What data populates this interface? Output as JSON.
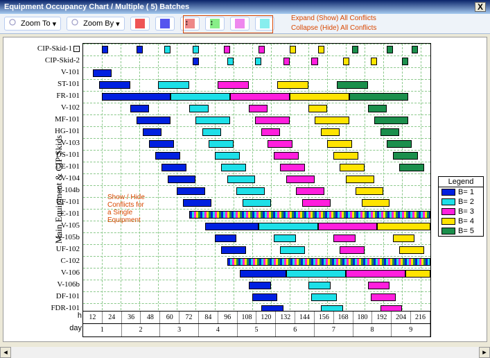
{
  "window": {
    "title": "Equipment Occupancy Chart / Multiple ( 5) Batches",
    "close": "X"
  },
  "toolbar": {
    "zoom_to": "Zoom To",
    "zoom_by": "Zoom By",
    "callout_expand": "Expand (Show) All Conflicts",
    "callout_collapse": "Collapse (Hide) All Conflicts"
  },
  "annotation_single": "Show / Hide\nConflicts for\na Single\nEquipment",
  "y_axis_label": "Main Equipment & CIP Skids",
  "legend": {
    "title": "Legend",
    "items": [
      "B= 1",
      "B= 2",
      "B= 3",
      "B= 4",
      "B= 5"
    ]
  },
  "x_axis": {
    "label_h": "h",
    "label_day": "day",
    "hours": [
      "12",
      "24",
      "36",
      "48",
      "60",
      "72",
      "84",
      "96",
      "108",
      "120",
      "132",
      "144",
      "156",
      "168",
      "180",
      "192",
      "204",
      "216"
    ],
    "days": [
      "1",
      "2",
      "3",
      "4",
      "5",
      "6",
      "7",
      "8",
      "9"
    ]
  },
  "chart_data": {
    "type": "gantt",
    "title": "Equipment Occupancy Chart / Multiple ( 5) Batches",
    "xlabel": "h / day",
    "ylabel": "Main Equipment & CIP Skids",
    "xlim": [
      0,
      222
    ],
    "equipment": [
      "CIP-Skid-1",
      "CIP-Skid-2",
      "V-101",
      "ST-101",
      "FR-101",
      "V-102",
      "MF-101",
      "HG-101",
      "V-103",
      "DS-101",
      "DE-101",
      "V-104",
      "V-104b",
      "UF-101",
      "C-101",
      "V-105",
      "V-105b",
      "UF-102",
      "C-102",
      "V-106",
      "V-106b",
      "DF-101",
      "FDR-101"
    ],
    "series_colors": {
      "1": "#0020e0",
      "2": "#1de0e8",
      "3": "#ff1fdd",
      "4": "#ffe400",
      "5": "#1b8f4c"
    },
    "bars": [
      {
        "eq": "CIP-Skid-1",
        "batch": 1,
        "start": 12,
        "end": 16
      },
      {
        "eq": "CIP-Skid-1",
        "batch": 1,
        "start": 34,
        "end": 38
      },
      {
        "eq": "CIP-Skid-1",
        "batch": 2,
        "start": 52,
        "end": 56
      },
      {
        "eq": "CIP-Skid-1",
        "batch": 2,
        "start": 70,
        "end": 74
      },
      {
        "eq": "CIP-Skid-1",
        "batch": 3,
        "start": 90,
        "end": 94
      },
      {
        "eq": "CIP-Skid-1",
        "batch": 3,
        "start": 112,
        "end": 116
      },
      {
        "eq": "CIP-Skid-1",
        "batch": 4,
        "start": 132,
        "end": 136
      },
      {
        "eq": "CIP-Skid-1",
        "batch": 4,
        "start": 150,
        "end": 154
      },
      {
        "eq": "CIP-Skid-1",
        "batch": 5,
        "start": 172,
        "end": 176
      },
      {
        "eq": "CIP-Skid-1",
        "batch": 5,
        "start": 194,
        "end": 198
      },
      {
        "eq": "CIP-Skid-1",
        "batch": 5,
        "start": 210,
        "end": 214
      },
      {
        "eq": "CIP-Skid-2",
        "batch": 1,
        "start": 70,
        "end": 74
      },
      {
        "eq": "CIP-Skid-2",
        "batch": 2,
        "start": 92,
        "end": 96
      },
      {
        "eq": "CIP-Skid-2",
        "batch": 2,
        "start": 110,
        "end": 114
      },
      {
        "eq": "CIP-Skid-2",
        "batch": 3,
        "start": 128,
        "end": 132
      },
      {
        "eq": "CIP-Skid-2",
        "batch": 3,
        "start": 146,
        "end": 150
      },
      {
        "eq": "CIP-Skid-2",
        "batch": 4,
        "start": 166,
        "end": 170
      },
      {
        "eq": "CIP-Skid-2",
        "batch": 4,
        "start": 184,
        "end": 188
      },
      {
        "eq": "CIP-Skid-2",
        "batch": 5,
        "start": 204,
        "end": 208
      },
      {
        "eq": "V-101",
        "batch": 1,
        "start": 6,
        "end": 18
      },
      {
        "eq": "ST-101",
        "batch": 1,
        "start": 10,
        "end": 30
      },
      {
        "eq": "ST-101",
        "batch": 2,
        "start": 48,
        "end": 68
      },
      {
        "eq": "ST-101",
        "batch": 3,
        "start": 86,
        "end": 106
      },
      {
        "eq": "ST-101",
        "batch": 4,
        "start": 124,
        "end": 144
      },
      {
        "eq": "ST-101",
        "batch": 5,
        "start": 162,
        "end": 182
      },
      {
        "eq": "FR-101",
        "batch": 1,
        "start": 12,
        "end": 56
      },
      {
        "eq": "FR-101",
        "batch": 2,
        "start": 56,
        "end": 94
      },
      {
        "eq": "FR-101",
        "batch": 3,
        "start": 94,
        "end": 132
      },
      {
        "eq": "FR-101",
        "batch": 4,
        "start": 132,
        "end": 170
      },
      {
        "eq": "FR-101",
        "batch": 5,
        "start": 170,
        "end": 208
      },
      {
        "eq": "V-102",
        "batch": 1,
        "start": 30,
        "end": 42
      },
      {
        "eq": "V-102",
        "batch": 2,
        "start": 68,
        "end": 80
      },
      {
        "eq": "V-102",
        "batch": 3,
        "start": 106,
        "end": 118
      },
      {
        "eq": "V-102",
        "batch": 4,
        "start": 144,
        "end": 156
      },
      {
        "eq": "V-102",
        "batch": 5,
        "start": 182,
        "end": 194
      },
      {
        "eq": "MF-101",
        "batch": 1,
        "start": 34,
        "end": 56
      },
      {
        "eq": "MF-101",
        "batch": 2,
        "start": 72,
        "end": 94
      },
      {
        "eq": "MF-101",
        "batch": 3,
        "start": 110,
        "end": 132
      },
      {
        "eq": "MF-101",
        "batch": 4,
        "start": 148,
        "end": 170
      },
      {
        "eq": "MF-101",
        "batch": 5,
        "start": 186,
        "end": 208
      },
      {
        "eq": "HG-101",
        "batch": 1,
        "start": 38,
        "end": 50
      },
      {
        "eq": "HG-101",
        "batch": 2,
        "start": 76,
        "end": 88
      },
      {
        "eq": "HG-101",
        "batch": 3,
        "start": 114,
        "end": 126
      },
      {
        "eq": "HG-101",
        "batch": 4,
        "start": 152,
        "end": 164
      },
      {
        "eq": "HG-101",
        "batch": 5,
        "start": 190,
        "end": 202
      },
      {
        "eq": "V-103",
        "batch": 1,
        "start": 42,
        "end": 58
      },
      {
        "eq": "V-103",
        "batch": 2,
        "start": 80,
        "end": 96
      },
      {
        "eq": "V-103",
        "batch": 3,
        "start": 118,
        "end": 134
      },
      {
        "eq": "V-103",
        "batch": 4,
        "start": 156,
        "end": 172
      },
      {
        "eq": "V-103",
        "batch": 5,
        "start": 194,
        "end": 210
      },
      {
        "eq": "DS-101",
        "batch": 1,
        "start": 46,
        "end": 62
      },
      {
        "eq": "DS-101",
        "batch": 2,
        "start": 84,
        "end": 100
      },
      {
        "eq": "DS-101",
        "batch": 3,
        "start": 122,
        "end": 138
      },
      {
        "eq": "DS-101",
        "batch": 4,
        "start": 160,
        "end": 176
      },
      {
        "eq": "DS-101",
        "batch": 5,
        "start": 198,
        "end": 214
      },
      {
        "eq": "DE-101",
        "batch": 1,
        "start": 50,
        "end": 66
      },
      {
        "eq": "DE-101",
        "batch": 2,
        "start": 88,
        "end": 104
      },
      {
        "eq": "DE-101",
        "batch": 3,
        "start": 126,
        "end": 142
      },
      {
        "eq": "DE-101",
        "batch": 4,
        "start": 164,
        "end": 180
      },
      {
        "eq": "DE-101",
        "batch": 5,
        "start": 202,
        "end": 218
      },
      {
        "eq": "V-104",
        "batch": 1,
        "start": 54,
        "end": 72
      },
      {
        "eq": "V-104",
        "batch": 2,
        "start": 92,
        "end": 110
      },
      {
        "eq": "V-104",
        "batch": 3,
        "start": 130,
        "end": 148
      },
      {
        "eq": "V-104",
        "batch": 4,
        "start": 168,
        "end": 186
      },
      {
        "eq": "V-104b",
        "batch": 1,
        "start": 60,
        "end": 78
      },
      {
        "eq": "V-104b",
        "batch": 2,
        "start": 98,
        "end": 116
      },
      {
        "eq": "V-104b",
        "batch": 3,
        "start": 136,
        "end": 154
      },
      {
        "eq": "V-104b",
        "batch": 4,
        "start": 174,
        "end": 192
      },
      {
        "eq": "UF-101",
        "batch": 1,
        "start": 64,
        "end": 82
      },
      {
        "eq": "UF-101",
        "batch": 2,
        "start": 102,
        "end": 120
      },
      {
        "eq": "UF-101",
        "batch": 3,
        "start": 140,
        "end": 158
      },
      {
        "eq": "UF-101",
        "batch": 4,
        "start": 178,
        "end": 196
      },
      {
        "eq": "C-101",
        "batch": 0,
        "start": 68,
        "end": 222,
        "striped": true
      },
      {
        "eq": "V-105",
        "batch": 1,
        "start": 78,
        "end": 112
      },
      {
        "eq": "V-105",
        "batch": 2,
        "start": 112,
        "end": 150
      },
      {
        "eq": "V-105",
        "batch": 3,
        "start": 150,
        "end": 188
      },
      {
        "eq": "V-105",
        "batch": 4,
        "start": 188,
        "end": 222
      },
      {
        "eq": "V-105b",
        "batch": 1,
        "start": 84,
        "end": 98
      },
      {
        "eq": "V-105b",
        "batch": 2,
        "start": 122,
        "end": 136
      },
      {
        "eq": "V-105b",
        "batch": 3,
        "start": 160,
        "end": 174
      },
      {
        "eq": "V-105b",
        "batch": 4,
        "start": 198,
        "end": 212
      },
      {
        "eq": "UF-102",
        "batch": 1,
        "start": 88,
        "end": 104
      },
      {
        "eq": "UF-102",
        "batch": 2,
        "start": 126,
        "end": 142
      },
      {
        "eq": "UF-102",
        "batch": 3,
        "start": 164,
        "end": 180
      },
      {
        "eq": "UF-102",
        "batch": 4,
        "start": 202,
        "end": 218
      },
      {
        "eq": "C-102",
        "batch": 0,
        "start": 92,
        "end": 222,
        "striped": true
      },
      {
        "eq": "V-106",
        "batch": 1,
        "start": 100,
        "end": 130
      },
      {
        "eq": "V-106",
        "batch": 2,
        "start": 130,
        "end": 168
      },
      {
        "eq": "V-106",
        "batch": 3,
        "start": 168,
        "end": 206
      },
      {
        "eq": "V-106",
        "batch": 4,
        "start": 206,
        "end": 222
      },
      {
        "eq": "V-106b",
        "batch": 1,
        "start": 106,
        "end": 120
      },
      {
        "eq": "V-106b",
        "batch": 2,
        "start": 144,
        "end": 158
      },
      {
        "eq": "V-106b",
        "batch": 3,
        "start": 182,
        "end": 196
      },
      {
        "eq": "DF-101",
        "batch": 1,
        "start": 108,
        "end": 124
      },
      {
        "eq": "DF-101",
        "batch": 2,
        "start": 146,
        "end": 162
      },
      {
        "eq": "DF-101",
        "batch": 3,
        "start": 184,
        "end": 200
      },
      {
        "eq": "FDR-101",
        "batch": 1,
        "start": 114,
        "end": 128
      },
      {
        "eq": "FDR-101",
        "batch": 2,
        "start": 152,
        "end": 166
      },
      {
        "eq": "FDR-101",
        "batch": 3,
        "start": 190,
        "end": 204
      }
    ]
  }
}
